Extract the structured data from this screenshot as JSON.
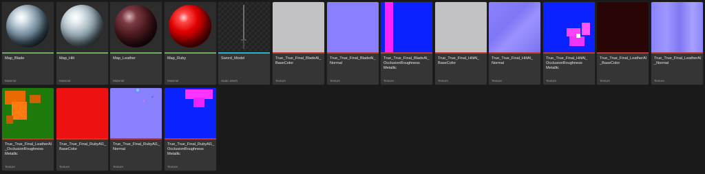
{
  "assets": [
    {
      "name": "Map_Blade",
      "type": "Material",
      "strip": "#6fae5c",
      "thumb": "sphere-steel"
    },
    {
      "name": "Map_Hilt",
      "type": "Material",
      "strip": "#6fae5c",
      "thumb": "sphere-silver"
    },
    {
      "name": "Map_Leather",
      "type": "Material",
      "strip": "#6fae5c",
      "thumb": "sphere-leather"
    },
    {
      "name": "Map_Ruby",
      "type": "Material",
      "strip": "#6fae5c",
      "thumb": "sphere-ruby"
    },
    {
      "name": "Sword_Model",
      "type": "Static Mesh",
      "strip": "#2ab7c9",
      "thumb": "sword"
    },
    {
      "name": "True_True_Final_BladeAl_\nBaseColor",
      "type": "Texture",
      "strip": "#c0392b",
      "thumb": "flat-grey"
    },
    {
      "name": "True_True_Final_BladeAl_\nNormal",
      "type": "Texture",
      "strip": "#c0392b",
      "thumb": "normal"
    },
    {
      "name": "True_True_Final_BladeAl_\nOcclusionRoughness\nMetallic",
      "type": "Texture",
      "strip": "#c0392b",
      "thumb": "orm-blade"
    },
    {
      "name": "True_True_Final_HiltAl_\nBaseColor",
      "type": "Texture",
      "strip": "#c0392b",
      "thumb": "flat-grey"
    },
    {
      "name": "True_True_Final_HiltAl_\nNormal",
      "type": "Texture",
      "strip": "#c0392b",
      "thumb": "normal-hilt"
    },
    {
      "name": "True_True_Final_HiltAl_\nOcclusionRoughness\nMetallic",
      "type": "Texture",
      "strip": "#c0392b",
      "thumb": "orm-hilt"
    },
    {
      "name": "True_True_Final_LeatherAl\n_BaseColor",
      "type": "Texture",
      "strip": "#c0392b",
      "thumb": "dark-red"
    },
    {
      "name": "True_True_Final_LeatherAl\n_Normal",
      "type": "Texture",
      "strip": "#c0392b",
      "thumb": "normal-leather"
    },
    {
      "name": "True_True_Final_LeatherAl\n_OcclusionRoughness\nMetallic",
      "type": "Texture",
      "strip": "#c0392b",
      "thumb": "orm-leather"
    },
    {
      "name": "True_True_Final_RubyAl1_\nBaseColor",
      "type": "Texture",
      "strip": "#c0392b",
      "thumb": "red"
    },
    {
      "name": "True_True_Final_RubyAl1_\nNormal",
      "type": "Texture",
      "strip": "#c0392b",
      "thumb": "normal-ruby"
    },
    {
      "name": "True_True_Final_RubyAl1_\nOcclusionRoughness\nMetallic",
      "type": "Texture",
      "strip": "#c0392b",
      "thumb": "orm-ruby"
    }
  ]
}
